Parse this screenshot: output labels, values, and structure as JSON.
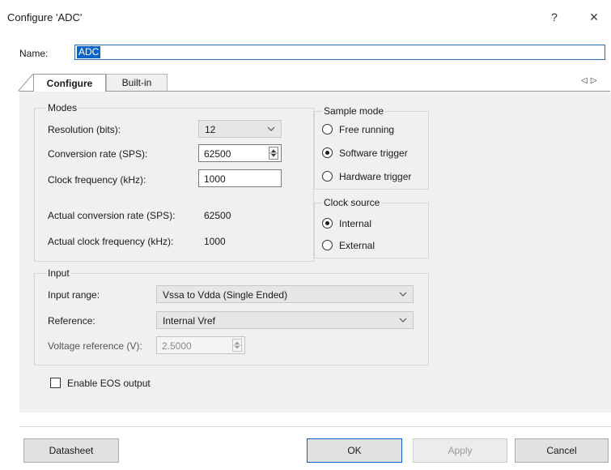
{
  "window": {
    "title": "Configure 'ADC'",
    "help_glyph": "?",
    "close_glyph": "×"
  },
  "name_field": {
    "label": "Name:",
    "value": "ADC"
  },
  "tabs": [
    {
      "label": "Configure",
      "active": true
    },
    {
      "label": "Built-in",
      "active": false
    }
  ],
  "tab_scroll": {
    "left": "◁",
    "right": "▷"
  },
  "modes": {
    "title": "Modes",
    "resolution": {
      "label": "Resolution (bits):",
      "value": "12"
    },
    "conversion_rate": {
      "label": "Conversion rate (SPS):",
      "value": "62500"
    },
    "clock_frequency": {
      "label": "Clock frequency (kHz):",
      "value": "1000"
    },
    "actual_conversion_rate": {
      "label": "Actual conversion rate (SPS):",
      "value": "62500"
    },
    "actual_clock_frequency": {
      "label": "Actual clock frequency (kHz):",
      "value": "1000"
    }
  },
  "sample_mode": {
    "title": "Sample mode",
    "options": [
      {
        "label": "Free running",
        "selected": false
      },
      {
        "label": "Software trigger",
        "selected": true
      },
      {
        "label": "Hardware trigger",
        "selected": false
      }
    ]
  },
  "clock_source": {
    "title": "Clock source",
    "options": [
      {
        "label": "Internal",
        "selected": true
      },
      {
        "label": "External",
        "selected": false
      }
    ]
  },
  "input": {
    "title": "Input",
    "input_range": {
      "label": "Input range:",
      "value": "Vssa to Vdda (Single Ended)"
    },
    "reference": {
      "label": "Reference:",
      "value": "Internal Vref"
    },
    "voltage_reference": {
      "label": "Voltage reference (V):",
      "value": "2.5000"
    }
  },
  "eos": {
    "label": "Enable EOS output",
    "checked": false
  },
  "buttons": {
    "datasheet": "Datasheet",
    "ok": "OK",
    "apply": "Apply",
    "cancel": "Cancel"
  }
}
